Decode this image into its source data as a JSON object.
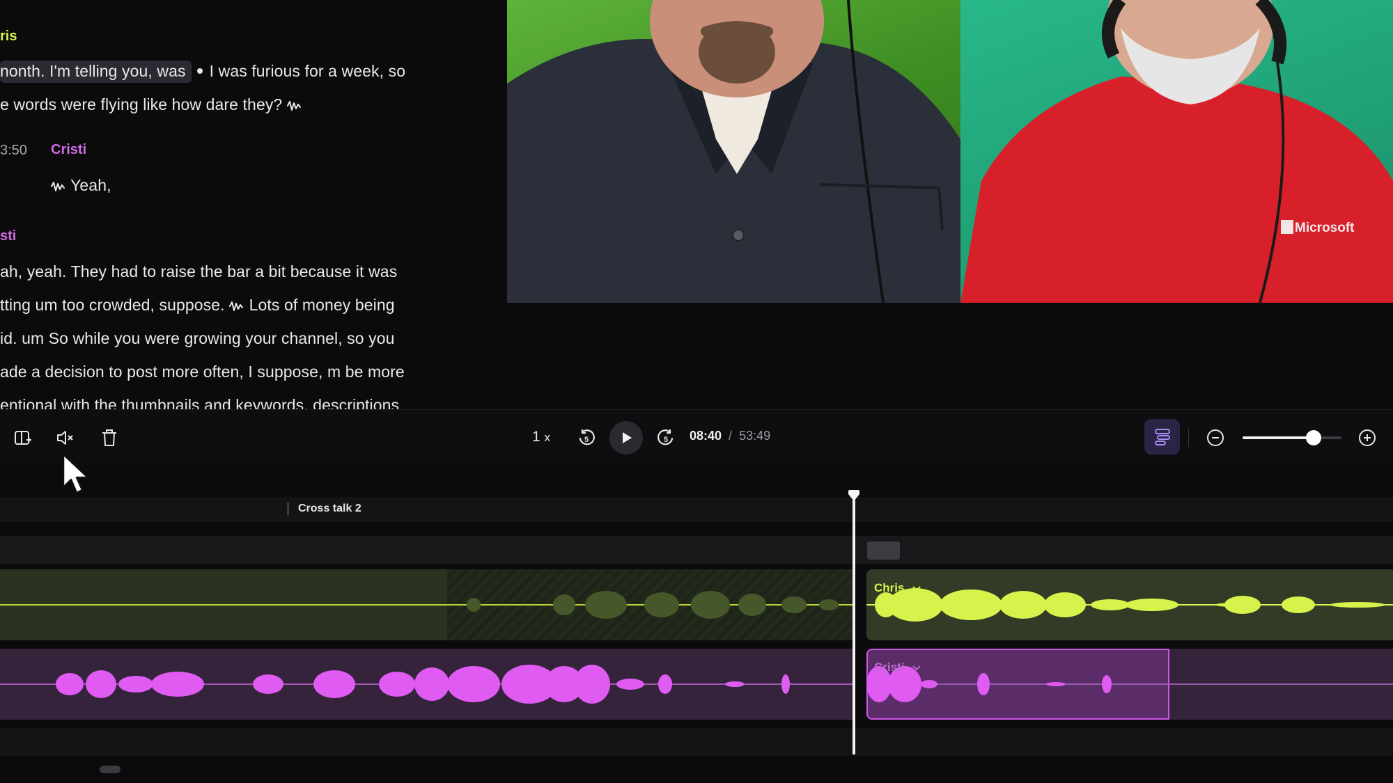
{
  "transcript": {
    "blocks": [
      {
        "speaker": "ris",
        "lines": [
          "nonth. I'm telling you, was",
          "I was furious for a week, so",
          "e words were flying like how  dare they?"
        ]
      },
      {
        "timestamp": "3:50",
        "speaker": "Cristi",
        "lines": [
          "Yeah,"
        ]
      },
      {
        "speaker": "sti",
        "lines": [
          "ah, yeah. They had to raise the bar a bit because it was",
          "tting um too crowded, suppose.",
          "Lots of money being",
          "id. um So while you were growing your channel, so you",
          "ade a decision to post more often, I suppose, m be more",
          "entional with the thumbnails and keywords, descriptions"
        ]
      }
    ]
  },
  "video": {
    "left_participant": "host-camera",
    "right_participant": "guest-camera",
    "shirt_logo_text": "Microsoft"
  },
  "toolbar": {
    "speed_value": "1",
    "speed_unit": "x",
    "current_time": "08:40",
    "separator": "/",
    "total_time": "53:49",
    "zoom_level": 0.72
  },
  "timeline": {
    "chapter_label": "Cross talk 2",
    "tracks": [
      {
        "name": "Chris",
        "color": "#d7f24a"
      },
      {
        "name": "Cristi",
        "color": "#e05bf2"
      }
    ],
    "playhead_time": "08:40"
  },
  "colors": {
    "green_speaker": "#d7f24a",
    "pink_speaker": "#d26ae6",
    "accent_purple": "#9b7cf2"
  }
}
